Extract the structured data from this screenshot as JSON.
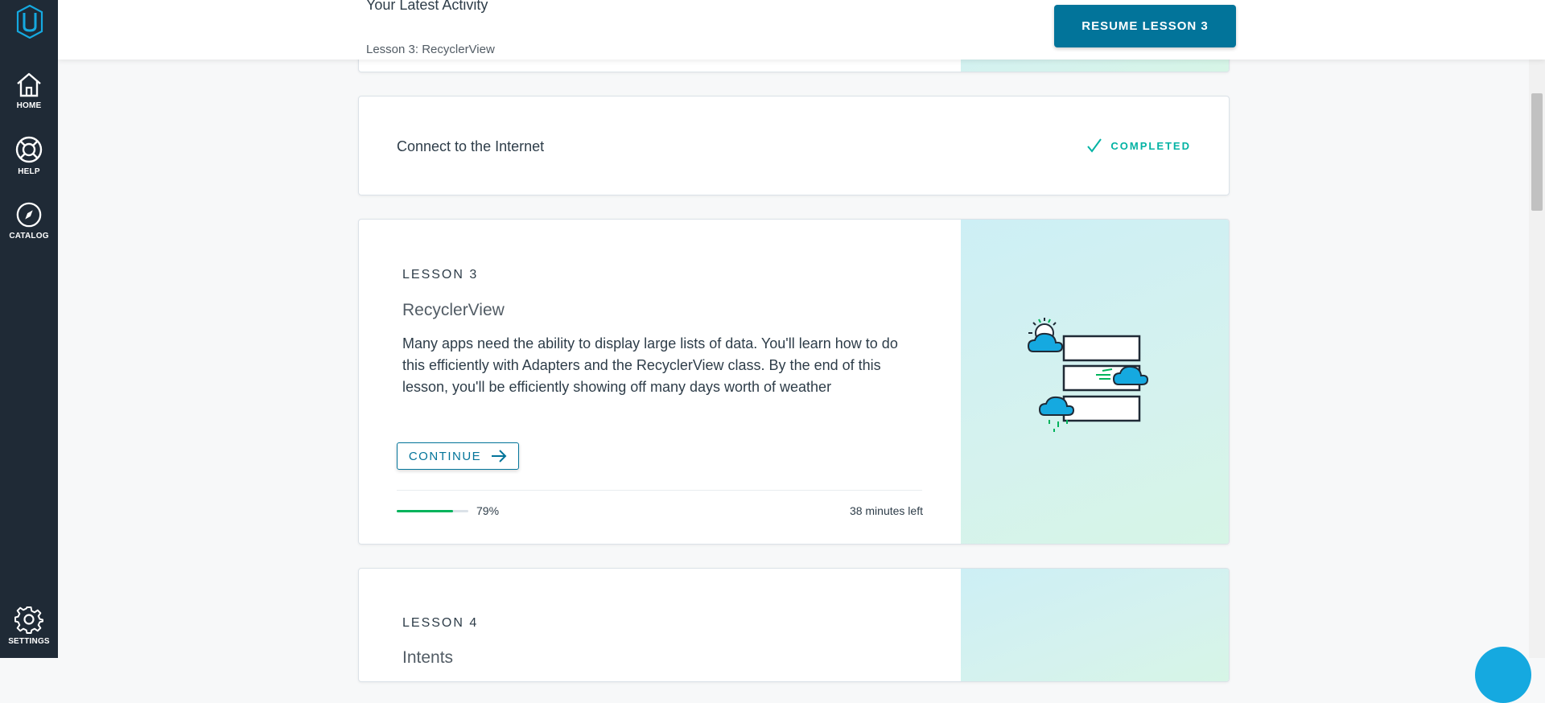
{
  "sidebar": {
    "items": [
      {
        "label": "HOME",
        "icon": "home-icon"
      },
      {
        "label": "HELP",
        "icon": "lifebuoy-icon"
      },
      {
        "label": "CATALOG",
        "icon": "compass-icon"
      },
      {
        "label": "SETTINGS",
        "icon": "gear-icon"
      }
    ]
  },
  "header": {
    "title": "Your Latest Activity",
    "subtitle": "Lesson 3: RecyclerView",
    "resume_label": "RESUME LESSON 3"
  },
  "completed": {
    "title": "Connect to the Internet",
    "status": "COMPLETED"
  },
  "lesson3": {
    "label": "LESSON 3",
    "title": "RecyclerView",
    "description": "Many apps need the ability to display large lists of data. You'll learn how to do this efficiently with Adapters and the RecyclerView class. By the end of this lesson, you'll be efficiently showing off many days worth of weather",
    "continue_label": "CONTINUE",
    "progress_percent": 79,
    "progress_text": "79%",
    "time_left": "38 minutes left"
  },
  "lesson4": {
    "label": "LESSON 4",
    "title": "Intents"
  },
  "colors": {
    "sidebar": "#1f2a36",
    "accent": "#02749a",
    "completed": "#02b3a4",
    "progress": "#02b35c",
    "cloud": "#15a9e0"
  }
}
